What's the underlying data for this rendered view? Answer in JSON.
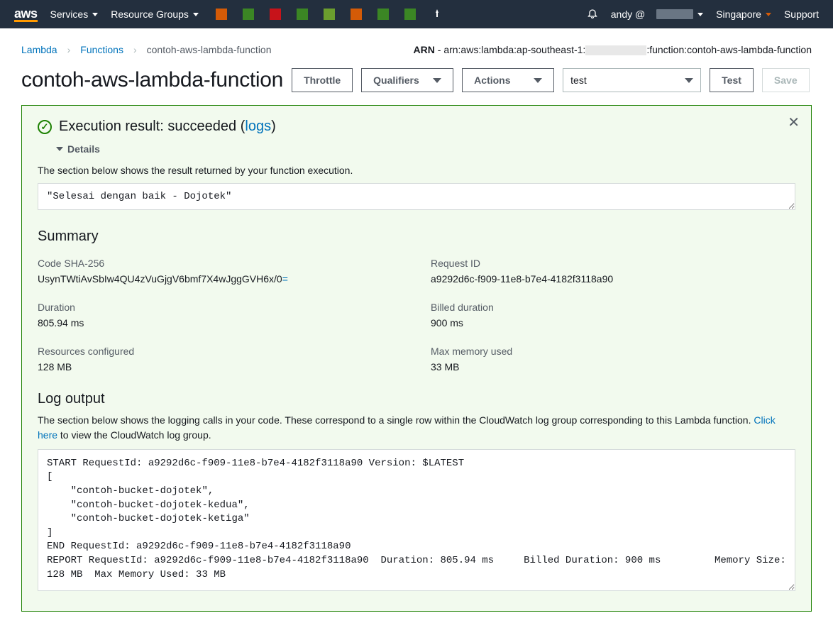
{
  "topnav": {
    "services": "Services",
    "resource_groups": "Resource Groups",
    "user_prefix": "andy @",
    "region": "Singapore",
    "support": "Support"
  },
  "breadcrumb": {
    "lambda": "Lambda",
    "functions": "Functions",
    "current": "contoh-aws-lambda-function"
  },
  "arn": {
    "label": "ARN",
    "prefix": "arn:aws:lambda:ap-southeast-1:",
    "suffix": ":function:contoh-aws-lambda-function"
  },
  "title": "contoh-aws-lambda-function",
  "buttons": {
    "throttle": "Throttle",
    "qualifiers": "Qualifiers",
    "actions": "Actions",
    "event_select": "test",
    "test": "Test",
    "save": "Save"
  },
  "result": {
    "header_prefix": "Execution result: succeeded (",
    "logs_link": "logs",
    "header_suffix": ")",
    "details_label": "Details",
    "section_desc": "The section below shows the result returned by your function execution.",
    "return_value": "\"Selesai dengan baik - Dojotek\"",
    "summary_title": "Summary",
    "items": [
      {
        "label": "Code SHA-256",
        "value_main": "UsynTWtiAvSbIw4QU4zVuGjgV6bmf7X4wJggGVH6x/0",
        "value_eq": "="
      },
      {
        "label": "Request ID",
        "value_main": "a9292d6c-f909-11e8-b7e4-4182f3118a90",
        "value_eq": ""
      },
      {
        "label": "Duration",
        "value_main": "805.94 ms",
        "value_eq": ""
      },
      {
        "label": "Billed duration",
        "value_main": "900 ms",
        "value_eq": ""
      },
      {
        "label": "Resources configured",
        "value_main": "128 MB",
        "value_eq": ""
      },
      {
        "label": "Max memory used",
        "value_main": "33 MB",
        "value_eq": ""
      }
    ],
    "log_title": "Log output",
    "log_desc_1": "The section below shows the logging calls in your code. These correspond to a single row within the CloudWatch log group corresponding to this Lambda function. ",
    "log_link": "Click here",
    "log_desc_2": " to view the CloudWatch log group.",
    "log_content": "START RequestId: a9292d6c-f909-11e8-b7e4-4182f3118a90 Version: $LATEST\n[\n    \"contoh-bucket-dojotek\",\n    \"contoh-bucket-dojotek-kedua\",\n    \"contoh-bucket-dojotek-ketiga\"\n]\nEND RequestId: a9292d6c-f909-11e8-b7e4-4182f3118a90\nREPORT RequestId: a9292d6c-f909-11e8-b7e4-4182f3118a90\tDuration: 805.94 ms\tBilled Duration: 900 ms \tMemory Size: 128 MB\tMax Memory Used: 33 MB\t"
  }
}
